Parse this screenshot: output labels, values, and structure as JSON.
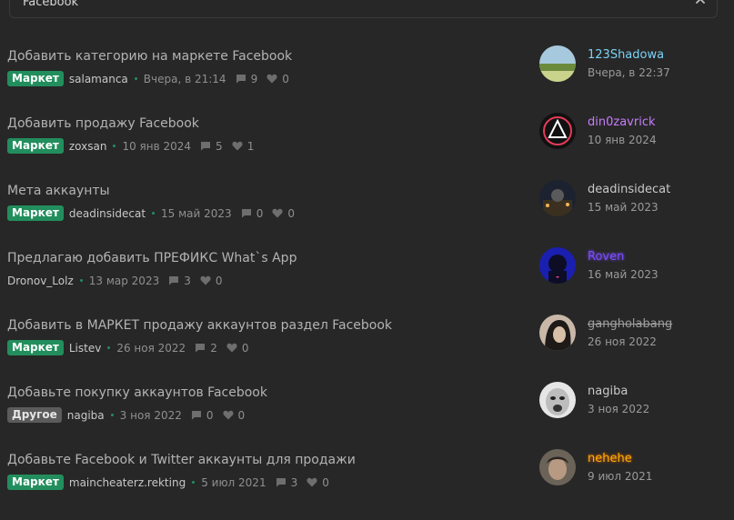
{
  "search": {
    "query": "Facebook"
  },
  "threads": [
    {
      "title": "Добавить категорию на маркете Facebook",
      "prefix": "Маркет",
      "author": "salamanca",
      "date": "Вчера, в 21:14",
      "replies": "9",
      "likes": "0",
      "last_user": "123Shadowa",
      "last_date": "Вчера, в 22:37"
    },
    {
      "title": "Добавить продажу Facebook",
      "prefix": "Маркет",
      "author": "zoxsan",
      "date": "10 янв 2024",
      "replies": "5",
      "likes": "1",
      "last_user": "din0zavrick",
      "last_date": "10 янв 2024"
    },
    {
      "title": "Мета аккаунты",
      "prefix": "Маркет",
      "author": "deadinsidecat",
      "date": "15 май 2023",
      "replies": "0",
      "likes": "0",
      "last_user": "deadinsidecat",
      "last_date": "15 май 2023"
    },
    {
      "title": "Предлагаю добавить ПРЕФИКС What`s App",
      "prefix": "",
      "author": "Dronov_Lolz",
      "date": "13 мар 2023",
      "replies": "3",
      "likes": "0",
      "last_user": "Roven",
      "last_date": "16 май 2023"
    },
    {
      "title": "Добавить в МАРКЕТ продажу аккаунтов раздел Facebook",
      "prefix": "Маркет",
      "author": "Listev",
      "date": "26 ноя 2022",
      "replies": "2",
      "likes": "0",
      "last_user": "gangholabang",
      "last_date": "26 ноя 2022"
    },
    {
      "title": "Добавьте покупку аккаунтов Facebook",
      "prefix": "Другое",
      "author": "nagiba",
      "date": "3 ноя 2022",
      "replies": "0",
      "likes": "0",
      "last_user": "nagiba",
      "last_date": "3 ноя 2022"
    },
    {
      "title": "Добавьте Facebook и Twitter аккаунты для продажи",
      "prefix": "Маркет",
      "author": "maincheaterz.rekting",
      "date": "5 июл 2021",
      "replies": "3",
      "likes": "0",
      "last_user": "nehehe",
      "last_date": "9 июл 2021"
    }
  ],
  "colors": {
    "background": "#272727",
    "prefix_market": "#228e5d",
    "prefix_other": "#5b5b5b",
    "user_123Shadowa": "#7ad3f5",
    "user_din0zavrick": "#c77dff",
    "user_Roven": "#7b4dff",
    "user_gangholabang": "#9e9e9e",
    "user_nehehe": "#ffb300"
  },
  "icons": {
    "replies": "comment-icon",
    "likes": "heart-icon",
    "clear": "close-icon"
  }
}
